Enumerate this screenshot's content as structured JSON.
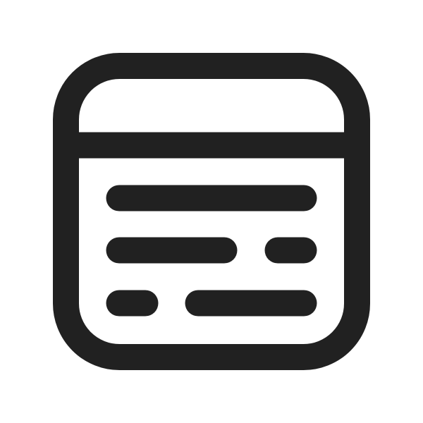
{
  "icon": {
    "name": "window-text-icon",
    "color": "#212121",
    "background": "#ffffff"
  }
}
